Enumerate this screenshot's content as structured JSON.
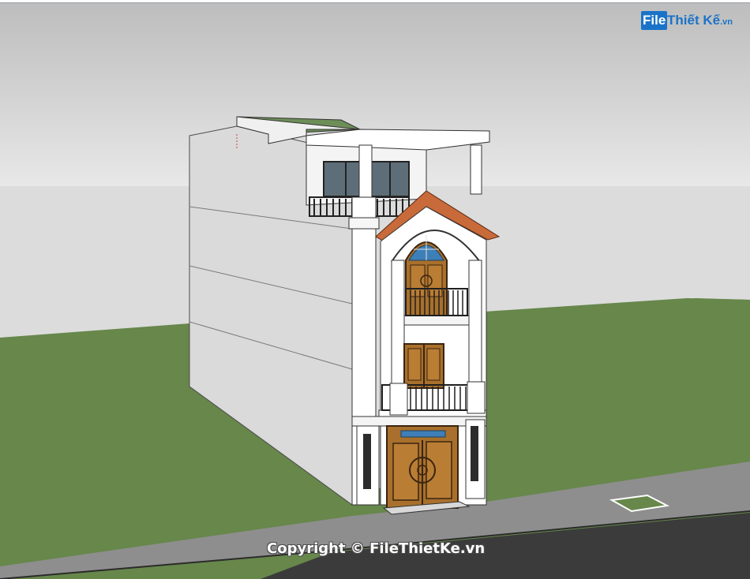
{
  "watermark": {
    "logo_mark": "File",
    "logo_text": "Thiết Kế",
    "logo_tld": ".vn",
    "copyright": "Copyright © FileThietKe.vn"
  },
  "colors": {
    "sky_top": "#bcbcbc",
    "sky_bottom": "#e6e6e6",
    "ground": "#66864a",
    "wall_white": "#ffffff",
    "side_wall": "#dcdcdc",
    "roof_tile": "#c9683a",
    "wood_door": "#a8702c",
    "railing": "#2a2a2a",
    "road": "#3d3d3d",
    "sidewalk": "#9a9a9a",
    "brand_blue": "#1a73c8"
  }
}
